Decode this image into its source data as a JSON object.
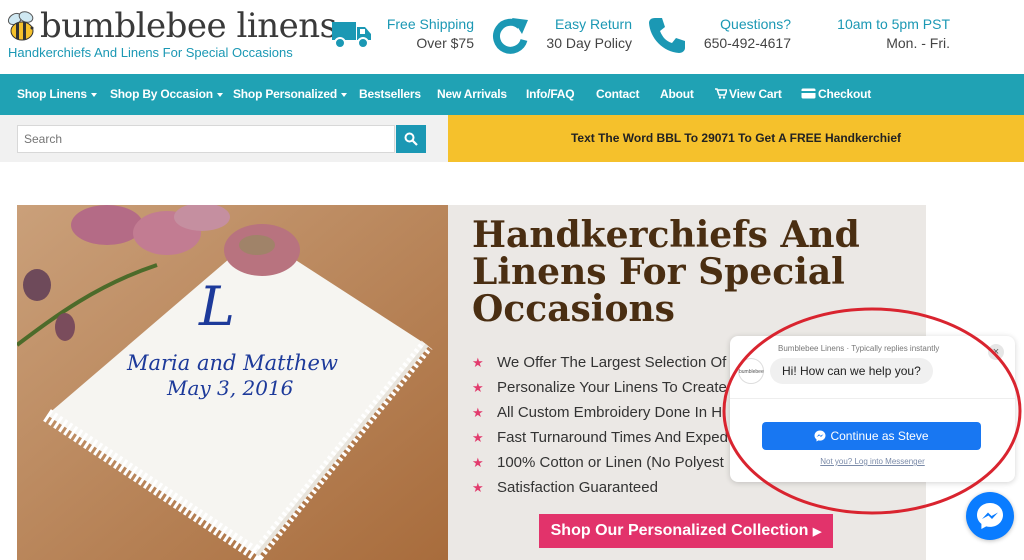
{
  "brand": {
    "name": "bumblebee linens",
    "tagline": "Handkerchiefs And Linens For Special Occasions"
  },
  "header_info": [
    {
      "icon": "truck-icon",
      "title": "Free Shipping",
      "subtitle": "Over $75"
    },
    {
      "icon": "return-arrow-icon",
      "title": "Easy Return",
      "subtitle": "30 Day Policy"
    },
    {
      "icon": "phone-icon",
      "title": "Questions?",
      "subtitle": "650-492-4617"
    },
    {
      "icon": "",
      "title": "10am to 5pm PST",
      "subtitle": "Mon. - Fri."
    }
  ],
  "nav": {
    "items": [
      {
        "label": "Shop Linens",
        "dropdown": true
      },
      {
        "label": "Shop By Occasion",
        "dropdown": true
      },
      {
        "label": "Shop Personalized",
        "dropdown": true
      },
      {
        "label": "Bestsellers",
        "dropdown": false
      },
      {
        "label": "New Arrivals",
        "dropdown": false
      },
      {
        "label": "Info/FAQ",
        "dropdown": false
      },
      {
        "label": "Contact",
        "dropdown": false
      },
      {
        "label": "About",
        "dropdown": false
      },
      {
        "label": "View Cart",
        "icon": "cart-icon"
      },
      {
        "label": "Checkout",
        "icon": "card-icon"
      }
    ]
  },
  "search": {
    "placeholder": "Search",
    "button_icon": "search-icon"
  },
  "promo": {
    "text": "Text The Word BBL To 29071 To Get A FREE Handkerchief"
  },
  "hero": {
    "image_text": {
      "monogram": "L",
      "names": "Maria and Matthew",
      "date": "May 3, 2016"
    },
    "title": "Handkerchiefs And Linens For Special Occasions",
    "bullets": [
      "We Offer The Largest Selection Of",
      "Personalize Your Linens To Create",
      "All Custom Embroidery Done In H",
      "Fast Turnaround Times And Exped",
      "100% Cotton or Linen (No Polyest",
      "Satisfaction Guaranteed"
    ],
    "cta": "Shop Our Personalized Collection"
  },
  "chat": {
    "page_name": "Bumblebee Linens",
    "status": "Typically replies instantly",
    "header": "Bumblebee Linens · Typically replies instantly",
    "avatar_text": "bumblebee",
    "message": "Hi! How can we help you?",
    "continue_button": "Continue as Steve",
    "alt_link": "Not you? Log into Messenger",
    "close_icon": "close-icon"
  },
  "colors": {
    "teal": "#20a2b4",
    "yellow": "#f5c12c",
    "pink": "#e2336b",
    "brown_title": "#4a2e12",
    "messenger_blue": "#1877f2",
    "annotation_red": "#d9242f"
  }
}
